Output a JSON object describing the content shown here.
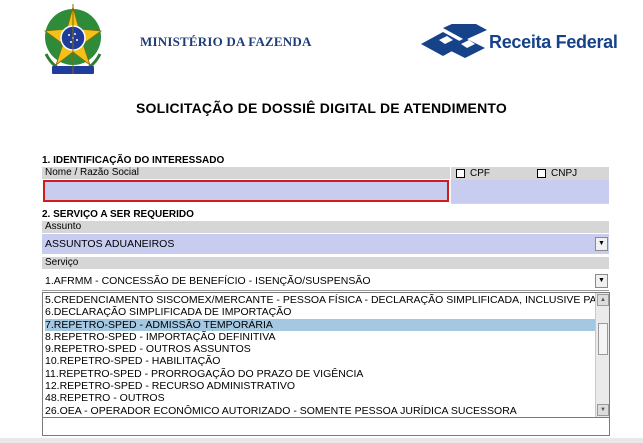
{
  "header": {
    "ministry": "MINISTÉRIO DA FAZENDA",
    "agency": "Receita Federal",
    "brand_color": "#16428a"
  },
  "document": {
    "title": "SOLICITAÇÃO DE DOSSIÊ DIGITAL DE ATENDIMENTO"
  },
  "section1": {
    "label": "1. IDENTIFICAÇÃO DO INTERESSADO",
    "name_field_label": "Nome / Razão Social",
    "name_value": "",
    "cpf_label": "CPF",
    "cnpj_label": "CNPJ",
    "cpf_checked": false,
    "cnpj_checked": false,
    "error_border_color": "#d01c1c"
  },
  "section2": {
    "label": "2. SERVIÇO A SER REQUERIDO",
    "assunto_label": "Assunto",
    "assunto_value": "ASSUNTOS ADUANEIROS",
    "servico_label": "Serviço",
    "servico_value": "1.AFRMM - CONCESSÃO DE BENEFÍCIO - ISENÇÃO/SUSPENSÃO",
    "dropdown_options": [
      "5.CREDENCIAMENTO SISCOMEX/MERCANTE - PESSOA FÍSICA - DECLARAÇÃO SIMPLIFICADA, INCLUSIVE PA",
      "6.DECLARAÇÃO SIMPLIFICADA DE IMPORTAÇÃO",
      "7.REPETRO-SPED - ADMISSÃO TEMPORÁRIA",
      "8.REPETRO-SPED - IMPORTAÇÃO DEFINITIVA",
      "9.REPETRO-SPED - OUTROS ASSUNTOS",
      "10.REPETRO-SPED - HABILITAÇÃO",
      "11.REPETRO-SPED - PRORROGAÇÃO DO PRAZO DE VIGÊNCIA",
      "12.REPETRO-SPED - RECURSO ADMINISTRATIVO",
      "48.REPETRO - OUTROS",
      "26.OEA - OPERADOR ECONÔMICO AUTORIZADO - SOMENTE PESSOA JURÍDICA SUCESSORA"
    ],
    "selected_option": "7.REPETRO-SPED - ADMISSÃO TEMPORÁRIA"
  },
  "icons": {
    "dropdown_arrow": "chevron-down-icon",
    "scroll_up": "scroll-up-icon",
    "scroll_down": "scroll-down-icon"
  }
}
